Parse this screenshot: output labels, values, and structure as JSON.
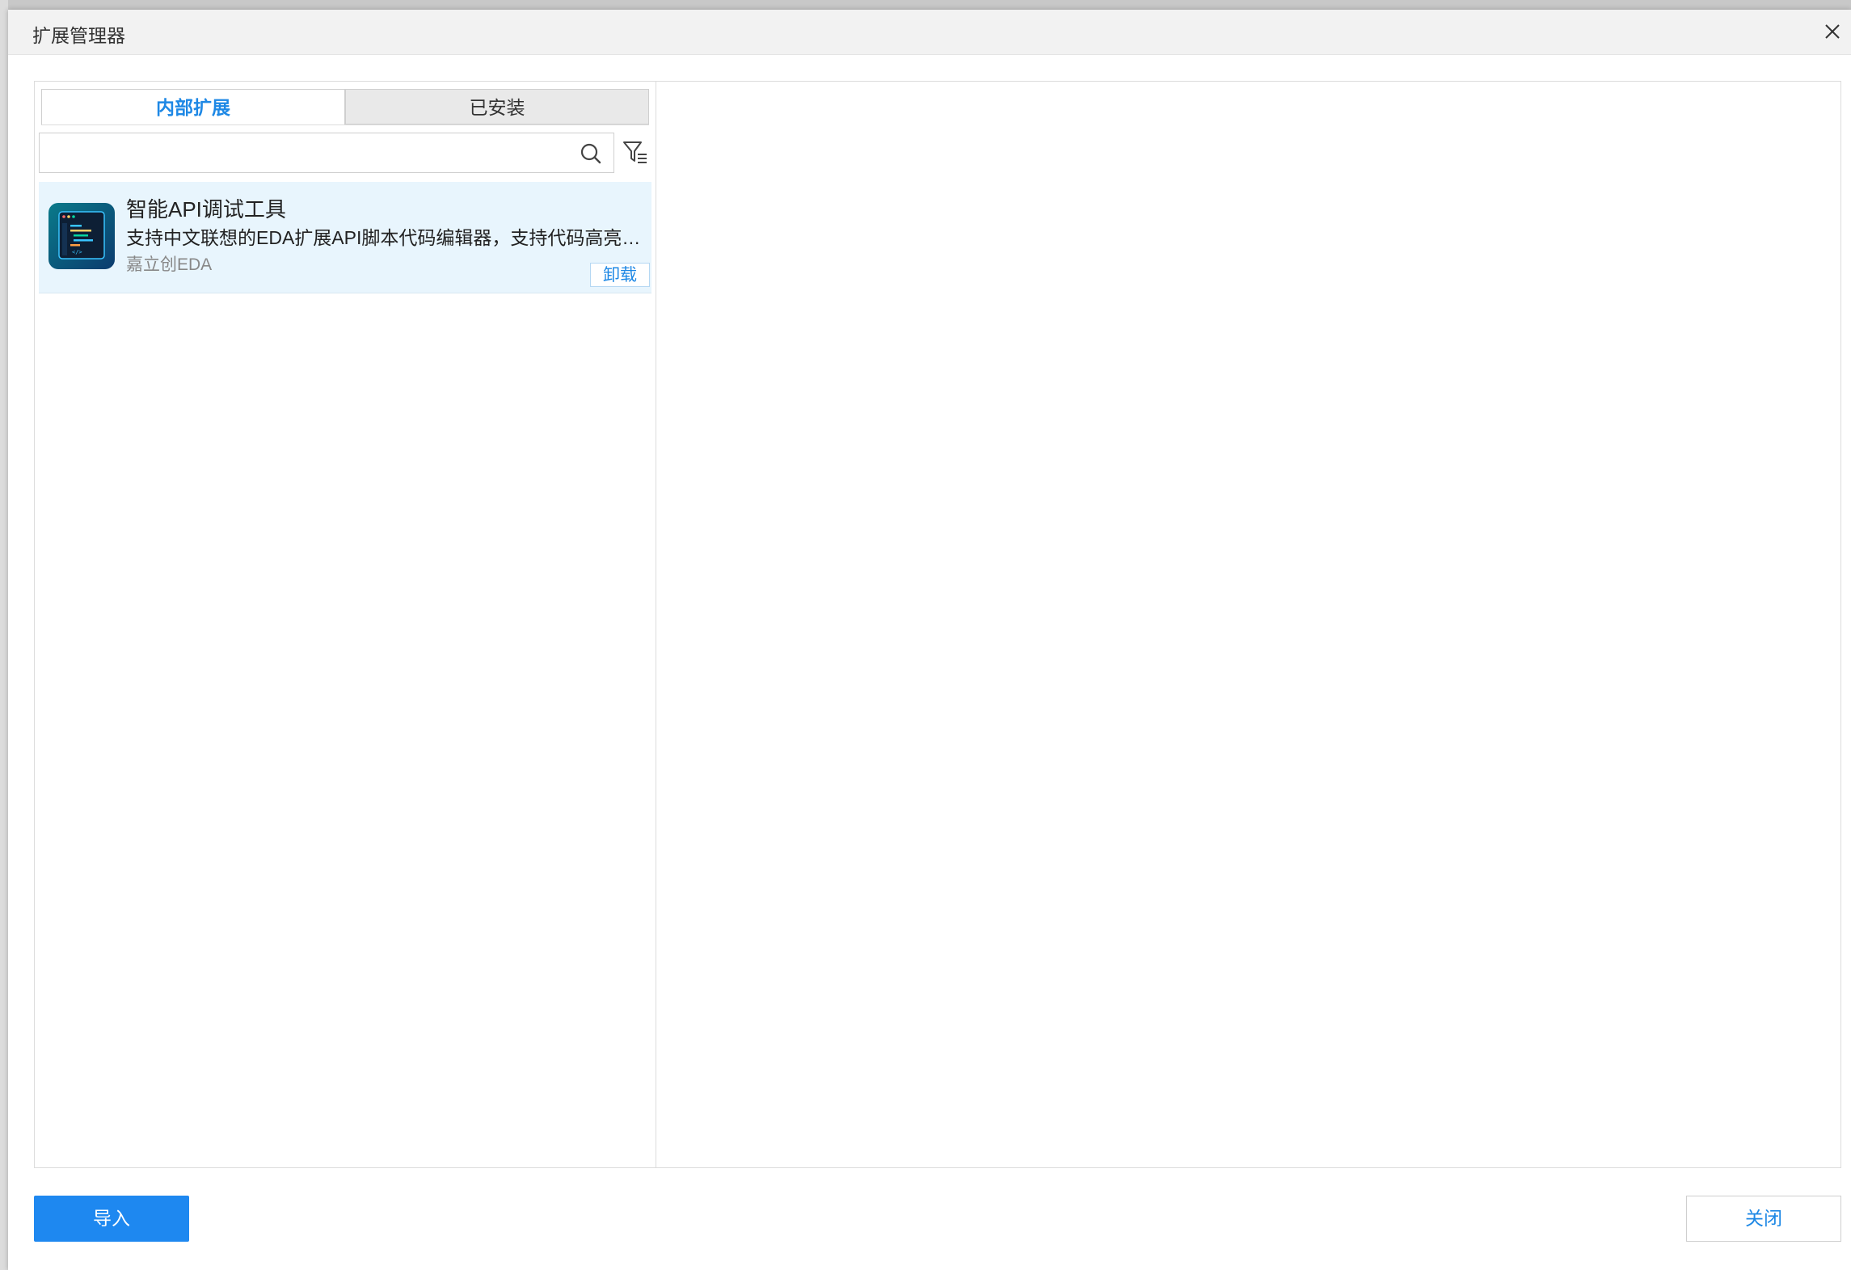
{
  "dialog": {
    "title": "扩展管理器"
  },
  "tabs": [
    {
      "label": "内部扩展",
      "active": true
    },
    {
      "label": "已安装",
      "active": false
    }
  ],
  "search": {
    "value": "",
    "placeholder": ""
  },
  "extensions": [
    {
      "name": "智能API调试工具",
      "description": "支持中文联想的EDA扩展API脚本代码编辑器，支持代码高亮、代码提示、代码格式化、运行调试等功能",
      "author": "嘉立创EDA",
      "action_label": "卸载",
      "icon": "code-editor-icon"
    }
  ],
  "footer": {
    "import_label": "导入",
    "close_label": "关闭"
  },
  "colors": {
    "accent": "#1e88e5",
    "primary_button": "#1e88f0",
    "selected_item_bg": "#e8f5fd"
  }
}
